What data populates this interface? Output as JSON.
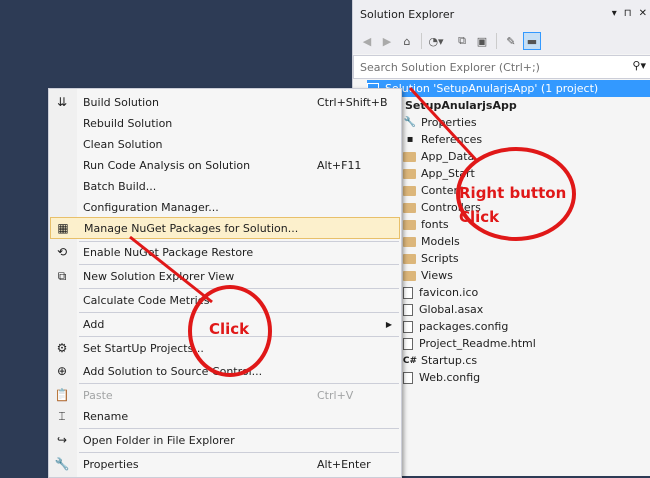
{
  "solution_explorer": {
    "title": "Solution Explorer",
    "title_controls": [
      "▾",
      "⊓",
      "✕"
    ],
    "search_placeholder": "Search Solution Explorer (Ctrl+;)",
    "toolbar_icons": [
      "back-icon",
      "forward-icon",
      "home-icon",
      "history-icon",
      "collapse-all-icon",
      "properties-icon",
      "pin-icon"
    ],
    "tree": [
      {
        "label": "Solution 'SetupAnularjsApp' (1 project)",
        "type": "solution",
        "selected": true
      },
      {
        "label": "SetupAnularjsApp",
        "type": "project"
      },
      {
        "label": "Properties",
        "type": "properties"
      },
      {
        "label": "References",
        "type": "references"
      },
      {
        "label": "App_Data",
        "type": "folder"
      },
      {
        "label": "App_Start",
        "type": "folder"
      },
      {
        "label": "Content",
        "type": "folder"
      },
      {
        "label": "Controllers",
        "type": "folder"
      },
      {
        "label": "fonts",
        "type": "folder"
      },
      {
        "label": "Models",
        "type": "folder"
      },
      {
        "label": "Scripts",
        "type": "folder"
      },
      {
        "label": "Views",
        "type": "folder"
      },
      {
        "label": "favicon.ico",
        "type": "file"
      },
      {
        "label": "Global.asax",
        "type": "file"
      },
      {
        "label": "packages.config",
        "type": "file"
      },
      {
        "label": "Project_Readme.html",
        "type": "file"
      },
      {
        "label": "Startup.cs",
        "type": "cs"
      },
      {
        "label": "Web.config",
        "type": "file"
      }
    ]
  },
  "context_menu": {
    "items": [
      {
        "label": "Build Solution",
        "shortcut": "Ctrl+Shift+B",
        "icon": "build-icon"
      },
      {
        "label": "Rebuild Solution",
        "shortcut": ""
      },
      {
        "label": "Clean Solution",
        "shortcut": ""
      },
      {
        "label": "Run Code Analysis on Solution",
        "shortcut": "Alt+F11"
      },
      {
        "label": "Batch Build...",
        "shortcut": ""
      },
      {
        "label": "Configuration Manager...",
        "shortcut": ""
      },
      {
        "label": "Manage NuGet Packages for Solution...",
        "shortcut": "",
        "icon": "nuget-icon",
        "highlighted": true
      },
      {
        "label": "Enable NuGet Package Restore",
        "shortcut": "",
        "icon": "restore-icon"
      },
      {
        "label": "New Solution Explorer View",
        "shortcut": "",
        "icon": "new-view-icon"
      },
      {
        "label": "Calculate Code Metrics",
        "shortcut": ""
      },
      {
        "label": "Add",
        "shortcut": "",
        "submenu": true
      },
      {
        "label": "Set StartUp Projects...",
        "shortcut": "",
        "icon": "gear-icon"
      },
      {
        "label": "Add Solution to Source Control...",
        "shortcut": "",
        "icon": "source-control-icon"
      },
      {
        "label": "Paste",
        "shortcut": "Ctrl+V",
        "icon": "paste-icon",
        "disabled": true
      },
      {
        "label": "Rename",
        "shortcut": "",
        "icon": "rename-icon"
      },
      {
        "label": "Open Folder in File Explorer",
        "shortcut": "",
        "icon": "open-folder-icon"
      },
      {
        "label": "Properties",
        "shortcut": "Alt+Enter",
        "icon": "wrench-icon"
      }
    ]
  },
  "annotations": {
    "right_click_label_line1": "Right button",
    "right_click_label_line2": "Click",
    "click_label": "Click",
    "color": "#e01818"
  }
}
